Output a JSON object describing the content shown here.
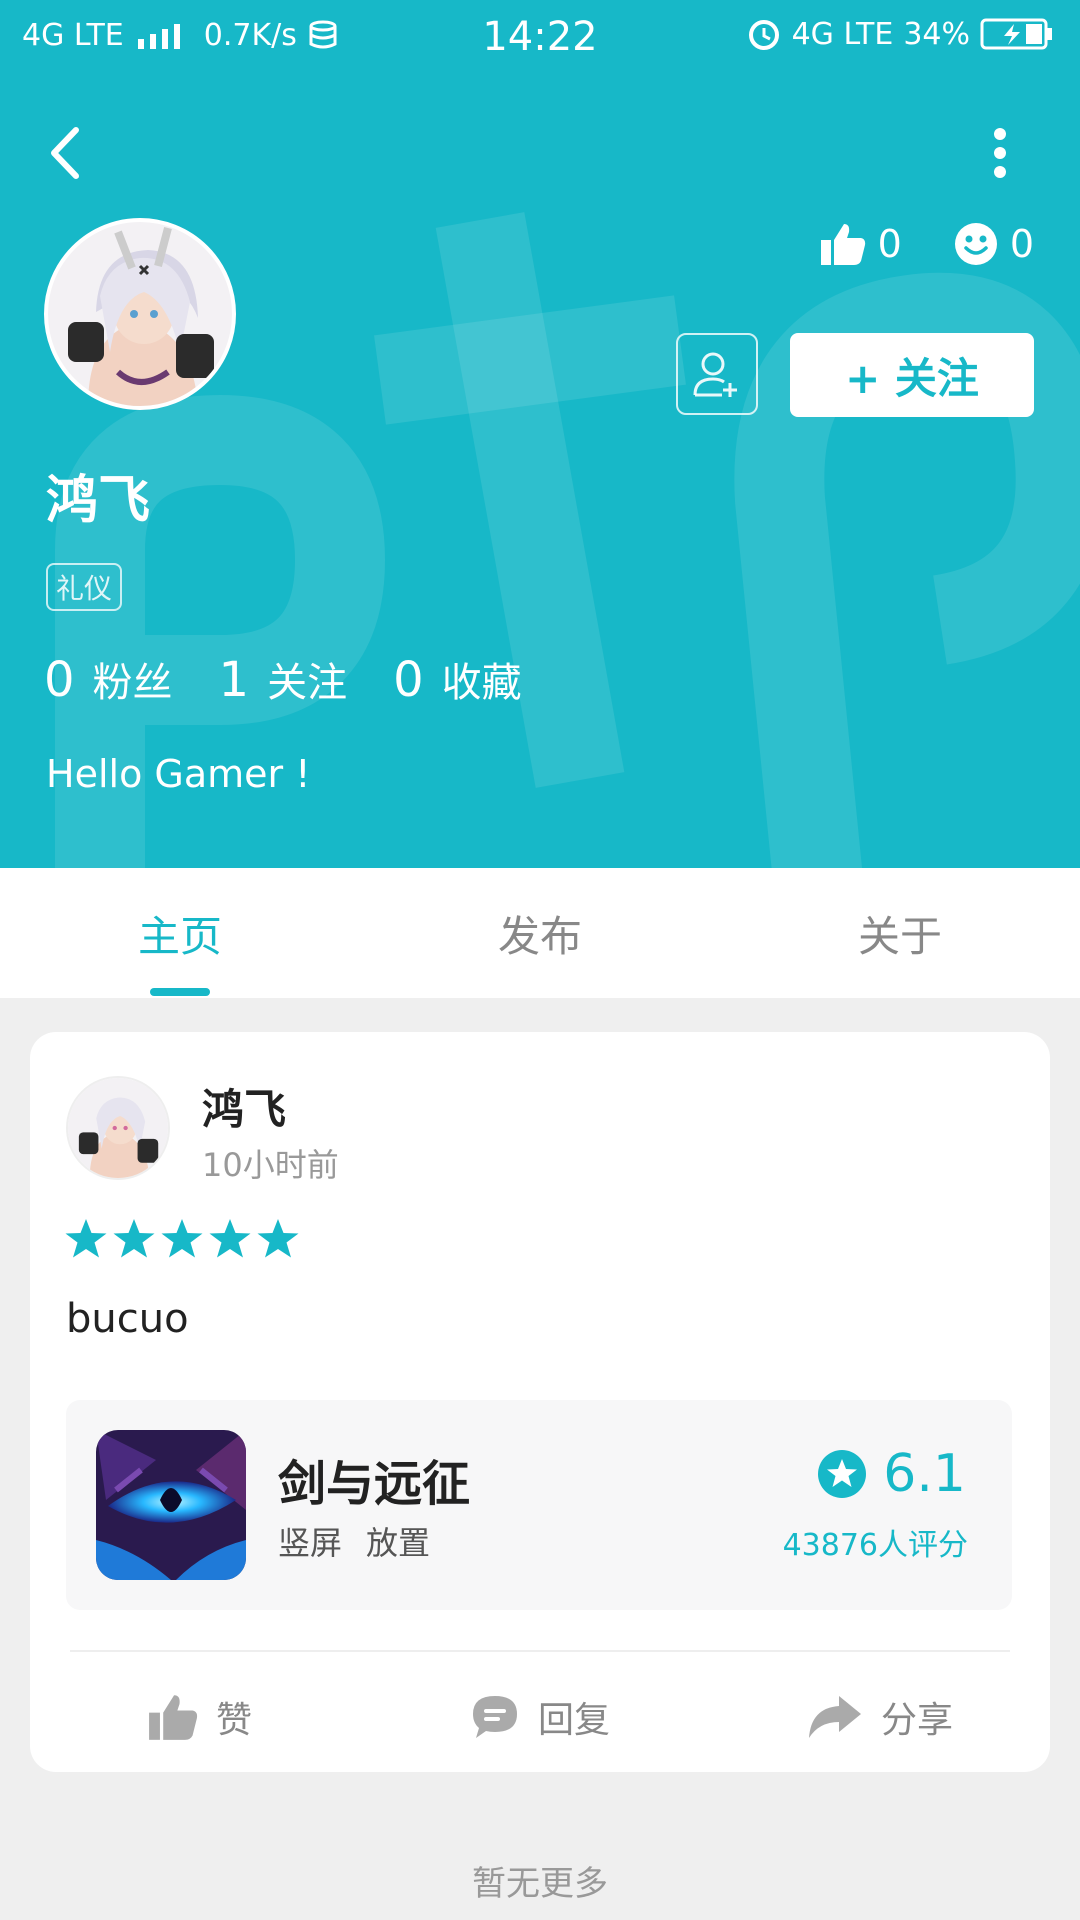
{
  "status_bar": {
    "network": "4G LTE",
    "speed": "0.7K/s",
    "time": "14:22",
    "network2": "4G LTE",
    "battery": "34%"
  },
  "profile": {
    "name": "鸿飞",
    "badge": "礼仪",
    "likes": "0",
    "smiles": "0",
    "follow_label": "+ 关注",
    "stats": [
      {
        "num": "0",
        "label": "粉丝"
      },
      {
        "num": "1",
        "label": "关注"
      },
      {
        "num": "0",
        "label": "收藏"
      }
    ],
    "bio": "Hello Gamer !"
  },
  "tabs": [
    {
      "label": "主页",
      "active": true
    },
    {
      "label": "发布",
      "active": false
    },
    {
      "label": "关于",
      "active": false
    }
  ],
  "post": {
    "author": "鸿飞",
    "time": "10小时前",
    "stars": 5,
    "content": "bucuo",
    "game": {
      "name": "剑与远征",
      "tags": [
        "竖屏",
        "放置"
      ],
      "rating": "6.1",
      "rating_count": "43876人评分"
    },
    "actions": {
      "like": "赞",
      "reply": "回复",
      "share": "分享"
    }
  },
  "footer": {
    "no_more": "暂无更多"
  },
  "colors": {
    "accent": "#17b8c8",
    "background": "#efefef"
  }
}
